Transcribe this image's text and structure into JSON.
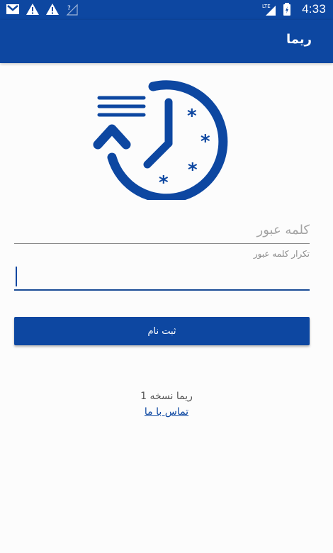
{
  "status_bar": {
    "time": "4:33",
    "left_icons": [
      "gmail-icon",
      "warning-icon",
      "warning-icon",
      "signal-icon"
    ],
    "right_icons": [
      "lte-signal-icon",
      "battery-icon"
    ]
  },
  "app_bar": {
    "title": "ریما"
  },
  "form": {
    "password_placeholder": "کلمه عبور",
    "password_value": "",
    "confirm_label": "تکرار کلمه عبور",
    "confirm_value": "",
    "register_label": "ثبت نام"
  },
  "footer": {
    "version": "ریما نسخه 1",
    "contact": "تماس با ما"
  },
  "colors": {
    "primary": "#0d47a1",
    "text_muted": "#8a8a8a"
  },
  "logo": "clock-history-icon"
}
